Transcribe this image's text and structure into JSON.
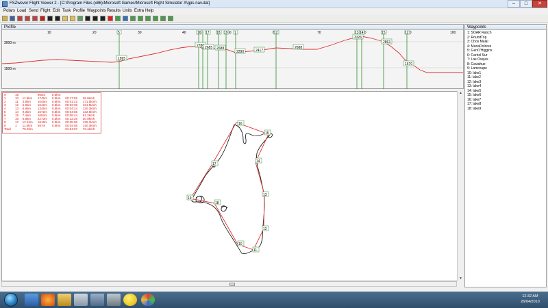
{
  "window": {
    "title": "FSZwever Flight Viewer 2 - [C:\\Program Files (x86)\\Microsoft Games\\Microsoft Flight Simulator X\\gps-nav.dat]"
  },
  "menu": [
    "Polars",
    "Load",
    "Send",
    "Flight",
    "Edit",
    "Task",
    "Profile",
    "Waypoints",
    "Results",
    "Units",
    "Extra",
    "Help"
  ],
  "toolbar": {
    "icons": [
      "open-icon",
      "save-icon",
      "plane-icon",
      "plane-icon",
      "plane-icon",
      "record-icon",
      "save-icon",
      "disk-icon",
      "folder-icon",
      "folder-icon",
      "open-icon",
      "save-icon",
      "save-icon",
      "disk-icon",
      "delete-icon",
      "plane-icon",
      "plane-icon",
      "window-icon",
      "window-icon",
      "window-icon",
      "window-icon",
      "window-icon",
      "window-icon"
    ],
    "colors": [
      "#d8b040",
      "#4060a0",
      "#c04040",
      "#c04040",
      "#c04040",
      "#c02020",
      "#202020",
      "#202020",
      "#e0c050",
      "#e0c050",
      "#60a060",
      "#202020",
      "#202020",
      "#202020",
      "#e02020",
      "#40a040",
      "#3070c0",
      "#4a9a4a",
      "#4a9a4a",
      "#4a9a4a",
      "#4a9a4a",
      "#4a9a4a",
      "#4a9a4a"
    ]
  },
  "profile": {
    "label": "Profile",
    "altitude_labels": [
      "3000 m",
      "1500 m"
    ],
    "distance_ticks": [
      "10",
      "20",
      "30",
      "40",
      "50",
      "60",
      "70",
      "80",
      "90",
      "100"
    ],
    "waypoint_markers": [
      "5",
      "16",
      "17",
      "18",
      "19",
      "1",
      "12",
      "13",
      "14",
      "15",
      "12",
      "18"
    ],
    "altitude_boxes": [
      "1995",
      "2780",
      "2685",
      "2688",
      "2290",
      "2417",
      "2688",
      "3326",
      "2863",
      "1670"
    ]
  },
  "stats": {
    "rows": [
      [
        "0",
        "18",
        "",
        "950m",
        "0.5km",
        "",
        ""
      ],
      [
        "1",
        "10",
        "11.9km",
        "1745m",
        "0.5km",
        "00:17:55",
        "39.9kmh"
      ],
      [
        "2",
        "11",
        "4.9km",
        "1645m",
        "0.5km",
        "00:01:42",
        "171.5kmh"
      ],
      [
        "3",
        "12",
        "5.8km",
        "1642m",
        "0.5km",
        "00:02:39",
        "131.9kmh"
      ],
      [
        "4",
        "13",
        "8.8km",
        "1345m",
        "0.5km",
        "00:04:24",
        "120.3kmh"
      ],
      [
        "5",
        "14",
        "9.3km",
        "1572m",
        "0.5km",
        "00:04:55",
        "132.5kmh"
      ],
      [
        "6",
        "15",
        "7.4km",
        "1663m",
        "0.5km",
        "00:08:44",
        "51.2kmh"
      ],
      [
        "7",
        "16",
        "6.8km",
        "2273m",
        "0.5km",
        "00:13:26",
        "30.9kmh"
      ],
      [
        "8",
        "17",
        "12.2km",
        "1918m",
        "0.5km",
        "00:05:05",
        "125.2kmh"
      ],
      [
        "9",
        "1",
        "11.5km",
        "597m",
        "0.5km",
        "00:04:56",
        "140.3kmh"
      ],
      [
        "Total",
        "",
        "79.0km",
        "",
        "",
        "01:04:07",
        "73.4kmh"
      ]
    ]
  },
  "map": {
    "task_color": "#e03030",
    "track_color": "#202020",
    "turnpoint_labels": [
      "16",
      "15",
      "14",
      "17",
      "13",
      "18",
      "19",
      "12",
      "10",
      "11"
    ]
  },
  "waypoints": {
    "title": "Waypoints",
    "items": [
      "1: SOAR Ranch",
      "2: RoundTop",
      "3: Chos Malal",
      "4: MariaDolores",
      "5: GenO'Higgins",
      "6: Carriel Sur",
      "7: Las Ovejas",
      "8: Caviahue",
      "9: Lamcoupe",
      "10: lake1",
      "11: lake2",
      "12: lake3",
      "13: lake4",
      "14: lake5",
      "15: lake6",
      "16: lake7",
      "17: lake8",
      "18: lake9"
    ]
  },
  "taskbar": {
    "time": "12:32 AM",
    "date": "26/04/2010"
  }
}
